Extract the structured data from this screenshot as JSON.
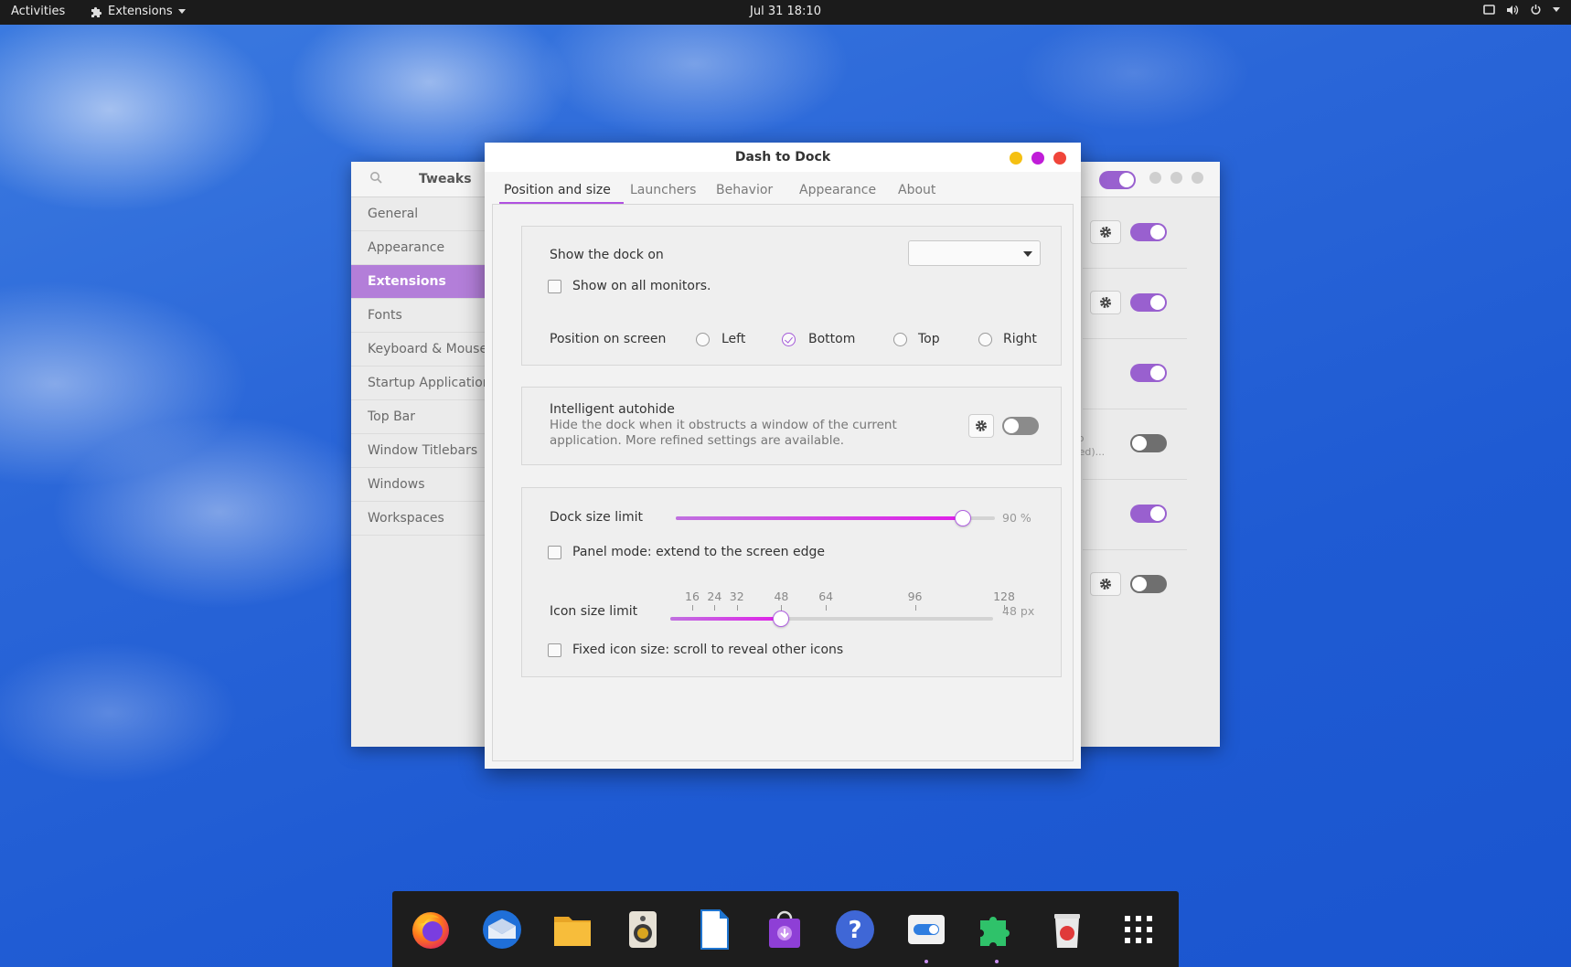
{
  "topbar": {
    "activities": "Activities",
    "app_menu": "Extensions",
    "clock": "Jul 31  18:10"
  },
  "tweaks": {
    "title": "Tweaks",
    "sidebar": [
      {
        "label": "General"
      },
      {
        "label": "Appearance"
      },
      {
        "label": "Extensions",
        "active": true
      },
      {
        "label": "Fonts"
      },
      {
        "label": "Keyboard & Mouse"
      },
      {
        "label": "Startup Applications"
      },
      {
        "label": "Top Bar"
      },
      {
        "label": "Window Titlebars"
      },
      {
        "label": "Windows"
      },
      {
        "label": "Workspaces"
      }
    ],
    "truncated_text_1": "h to",
    "truncated_text_2": "orted)...",
    "extension_toggles": [
      "on",
      "on",
      "on",
      "off",
      "on",
      "off"
    ]
  },
  "dialog": {
    "title": "Dash to Dock",
    "tabs": [
      "Position and size",
      "Launchers",
      "Behavior",
      "Appearance",
      "About"
    ],
    "active_tab": "Position and size",
    "show_dock_on_label": "Show the dock on",
    "show_dock_on_value": "",
    "show_all_monitors": "Show on all monitors.",
    "position_label": "Position on screen",
    "positions": [
      "Left",
      "Bottom",
      "Top",
      "Right"
    ],
    "selected_position": "Bottom",
    "autohide_title": "Intelligent autohide",
    "autohide_desc": "Hide the dock when it obstructs a window of the current application. More refined settings are available.",
    "autohide_enabled": false,
    "dock_size_label": "Dock size limit",
    "dock_size_value": "90 %",
    "dock_size_fraction": 0.9,
    "panel_mode": "Panel mode: extend to the screen edge",
    "icon_size_label": "Icon size limit",
    "icon_size_marks": [
      "16",
      "24",
      "32",
      "48",
      "64",
      "96",
      "128"
    ],
    "icon_size_value": "48 px",
    "icon_size_current": 48,
    "fixed_icon": "Fixed icon size: scroll to reveal other icons"
  },
  "dock": {
    "apps": [
      "firefox-icon",
      "thunderbird-icon",
      "files-icon",
      "rhythmbox-icon",
      "libreoffice-writer-icon",
      "software-icon",
      "help-icon",
      "settings-toggle-icon",
      "extensions-puzzle-icon",
      "trash-icon",
      "app-grid-icon"
    ]
  },
  "colors": {
    "accent": "#a45ad8",
    "toggle_on": "#9960cf",
    "close": "#f0453a",
    "maximize": "#c01cd8",
    "minimize": "#f5c012"
  }
}
